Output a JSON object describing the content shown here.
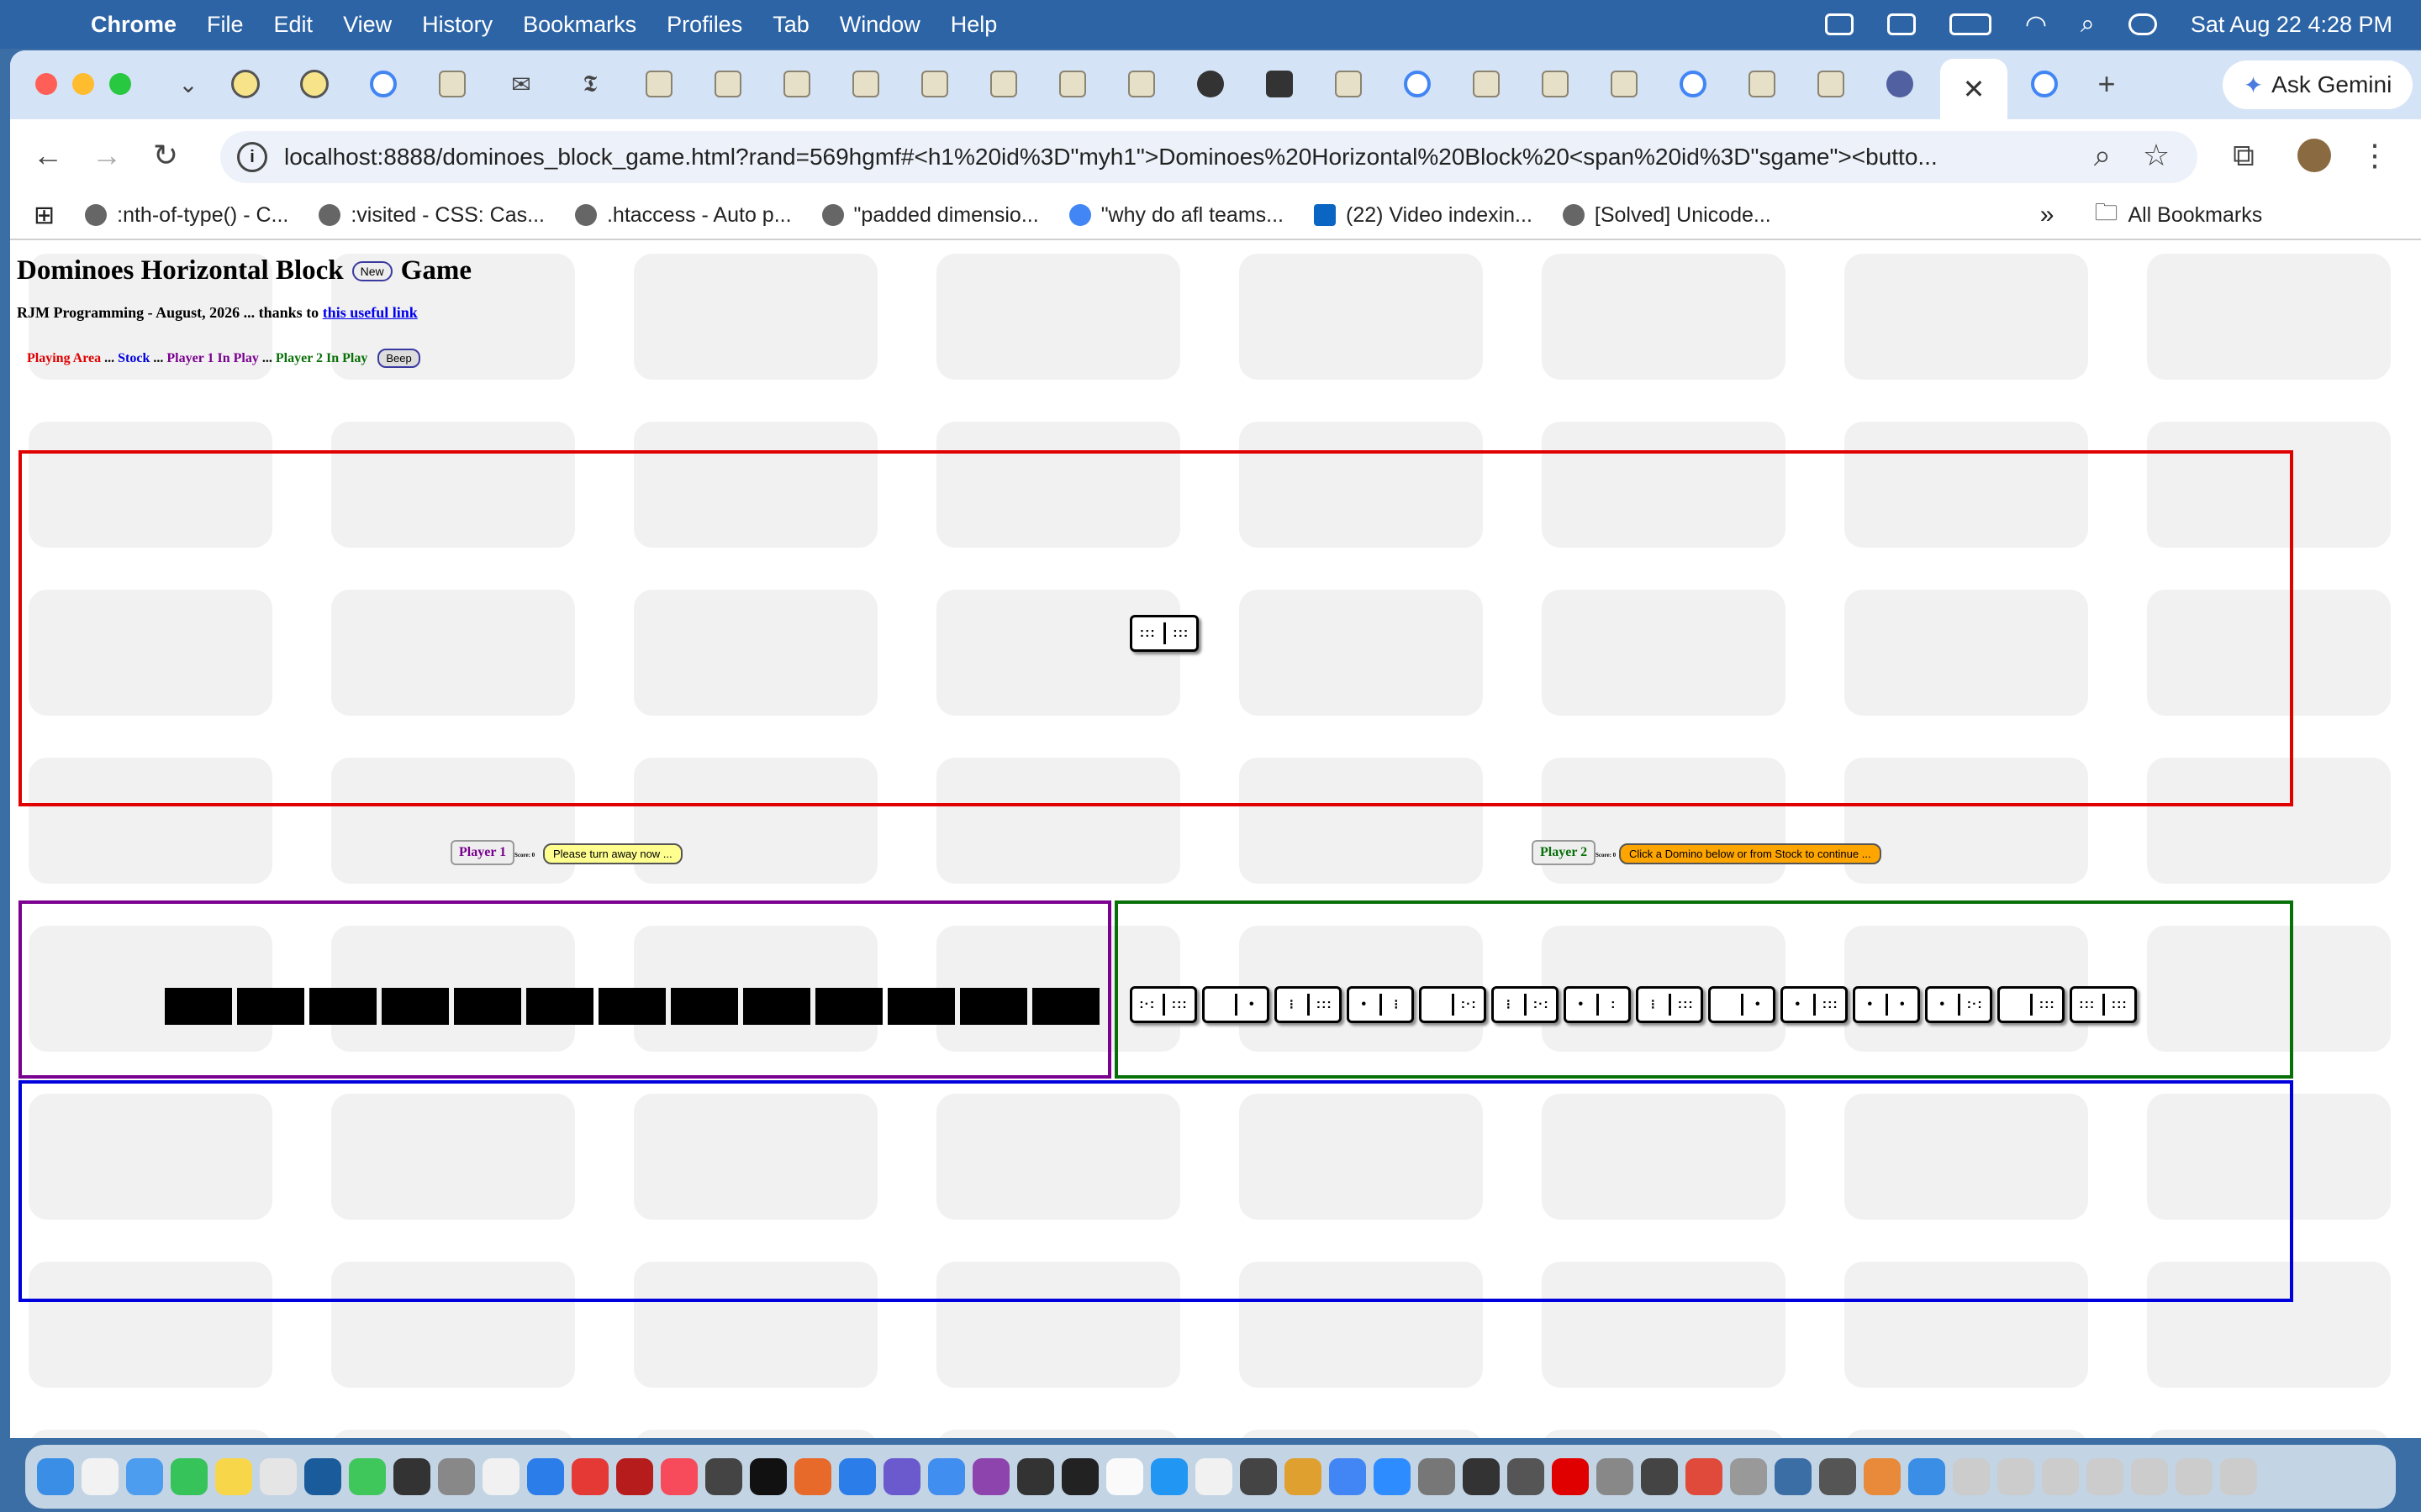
{
  "menubar": {
    "app": "Chrome",
    "items": [
      "File",
      "Edit",
      "View",
      "History",
      "Bookmarks",
      "Profiles",
      "Tab",
      "Window",
      "Help"
    ],
    "datetime": "Sat Aug 22  4:28 PM"
  },
  "browser": {
    "ask_gemini": "Ask Gemini",
    "url": "localhost:8888/dominoes_block_game.html?rand=569hgmf#<h1%20id%3D\"myh1\">Dominoes%20Horizontal%20Block%20<span%20id%3D\"sgame\"><butto...",
    "bookmarks": [
      ":nth-of-type() - C...",
      ":visited - CSS: Cas...",
      ".htaccess - Auto p...",
      "\"padded dimensio...",
      "\"why do afl teams...",
      "(22) Video indexin...",
      "[Solved] Unicode..."
    ],
    "all_bookmarks": "All Bookmarks",
    "more": "»"
  },
  "page": {
    "title_a": "Dominoes Horizontal Block",
    "new_button": "New",
    "title_b": "Game",
    "credit_text": "RJM Programming - August, 2026 ... thanks to ",
    "credit_link": "this useful link",
    "legend": {
      "playing": "Playing Area",
      "sep1": " ... ",
      "stock": "Stock",
      "sep2": "... ",
      "p1": "Player 1 In Play",
      "sep3": " ... ",
      "p2": "Player 2 In Play",
      "beep": "Beep"
    },
    "player1": {
      "label": "Player 1",
      "score": "Score: 0",
      "message": "Please turn away now ..."
    },
    "player2": {
      "label": "Player 2",
      "score": "Score: 0",
      "message": "Click a Domino below or from Stock to continue ..."
    },
    "played_domino": [
      6,
      6
    ],
    "player1_hidden_count": 13,
    "player2_hand": [
      [
        5,
        6
      ],
      [
        0,
        1
      ],
      [
        3,
        6
      ],
      [
        1,
        3
      ],
      [
        0,
        5
      ],
      [
        3,
        5
      ],
      [
        1,
        2
      ],
      [
        3,
        6
      ],
      [
        0,
        1
      ],
      [
        1,
        6
      ],
      [
        1,
        1
      ],
      [
        1,
        5
      ],
      [
        0,
        6
      ],
      [
        6,
        6
      ]
    ]
  },
  "colors": {
    "playing_border": "#e00000",
    "stock_border": "#0000dd",
    "p1_border": "#7a0090",
    "p2_border": "#087008"
  }
}
